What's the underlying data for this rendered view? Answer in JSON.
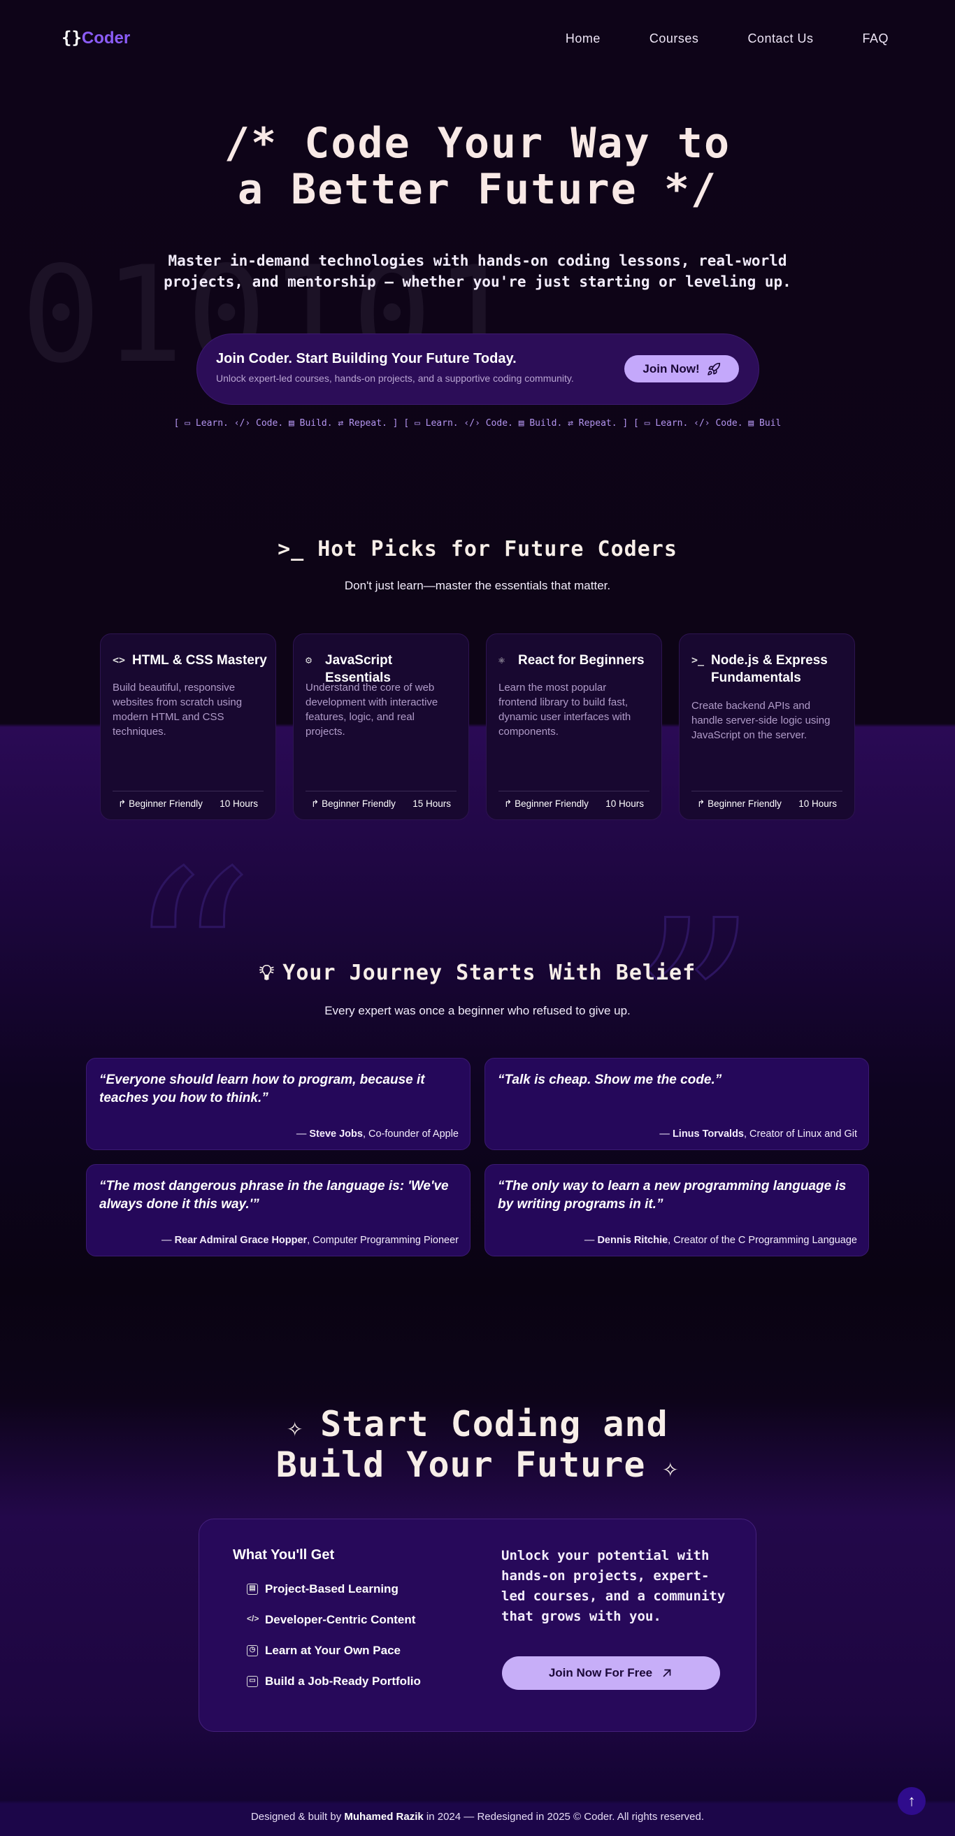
{
  "nav": {
    "logo_brace": "{}",
    "logo_name": "Coder",
    "links": [
      "Home",
      "Courses",
      "Contact Us",
      "FAQ"
    ]
  },
  "hero": {
    "bg_text": "010101",
    "title_line1": "/* Code Your Way to",
    "title_line2": "a Better Future */",
    "subtitle_line1": "Master in-demand technologies with hands-on coding lessons, real-world",
    "subtitle_line2": "projects, and mentorship — whether you're just starting or leveling up.",
    "cta_heading": "Join Coder. Start Building Your Future Today.",
    "cta_text": "Unlock expert-led courses, hands-on projects, and a supportive coding community.",
    "cta_button": "Join Now!",
    "ticker": "[ ▭ Learn. ‹/› Code. ▤ Build. ⇄ Repeat. ] [ ▭ Learn. ‹/› Code. ▤ Build. ⇄ Repeat. ] [ ▭ Learn. ‹/› Code. ▤ Buil"
  },
  "hot_picks": {
    "title": "Hot Picks for Future Coders",
    "subtitle": "Don't just learn—master the essentials that matter.",
    "courses": [
      {
        "icon": "code-icon",
        "title": "HTML & CSS Mastery",
        "desc": "Build beautiful, responsive websites from scratch using modern HTML and CSS techniques.",
        "level": "Beginner Friendly",
        "hours": "10 Hours"
      },
      {
        "icon": "gear-icon",
        "title": "JavaScript Essentials",
        "desc": "Understand the core of web development with interactive features, logic, and real projects.",
        "level": "Beginner Friendly",
        "hours": "15 Hours"
      },
      {
        "icon": "react-icon",
        "title": "React for Beginners",
        "desc": "Learn the most popular frontend library to build fast, dynamic user interfaces with components.",
        "level": "Beginner Friendly",
        "hours": "10 Hours"
      },
      {
        "icon": "terminal-icon",
        "title": "Node.js & Express Fundamentals",
        "desc": "Create backend APIs and handle server-side logic using JavaScript on the server.",
        "level": "Beginner Friendly",
        "hours": "10 Hours"
      }
    ]
  },
  "journey": {
    "title": "Your Journey Starts With Belief",
    "subtitle": "Every expert was once a beginner who refused to give up.",
    "quotes": [
      {
        "text": "“Everyone should learn how to program, because it teaches you how to think.”",
        "author": "Steve Jobs",
        "role": ", Co-founder of Apple"
      },
      {
        "text": "“Talk is cheap. Show me the code.”",
        "author": "Linus Torvalds",
        "role": ", Creator of Linux and Git"
      },
      {
        "text": "“The most dangerous phrase in the language is: 'We've always done it this way.'”",
        "author": "Rear Admiral Grace Hopper",
        "role": ", Computer Programming Pioneer"
      },
      {
        "text": "“The only way to learn a new programming language is by writing programs in it.”",
        "author": "Dennis Ritchie",
        "role": ", Creator of the C Programming Language"
      }
    ]
  },
  "start": {
    "title_line1": "Start Coding and",
    "title_line2": "Build Your Future",
    "box_heading": "What You'll Get",
    "features": [
      "Project-Based Learning",
      "Developer-Centric Content",
      "Learn at Your Own Pace",
      "Build a Job-Ready Portfolio"
    ],
    "pitch": "Unlock your potential with hands-on projects, expert-led courses, and a community that grows with you.",
    "button": "Join Now For Free"
  },
  "footer": {
    "prefix": "Designed & built by ",
    "name": "Muhamed Razik",
    "suffix": " in 2024 — Redesigned in 2025 © Coder. All rights reserved."
  },
  "colors": {
    "accent": "#8b5cf6",
    "button": "#c4a8fb",
    "background": "#0c0414",
    "section": "#27095a"
  }
}
